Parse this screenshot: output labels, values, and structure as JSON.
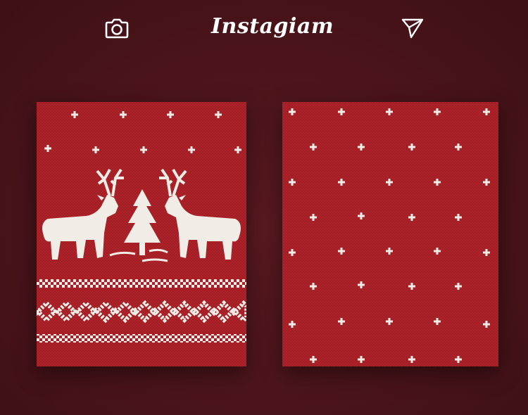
{
  "header": {
    "logo_text": "Instagiam",
    "left_icon": "camera-icon",
    "right_icon": "send-icon"
  },
  "feed": {
    "cards": [
      {
        "pattern": "reindeer-tree-knit"
      },
      {
        "pattern": "snowflake-dot-knit"
      }
    ]
  },
  "colors": {
    "background": "#4a141a",
    "knit_red": "#b0232a",
    "knit_red_dark": "#9c1c23",
    "knit_cream": "#f1ede6",
    "icon_white": "#ffffff"
  }
}
